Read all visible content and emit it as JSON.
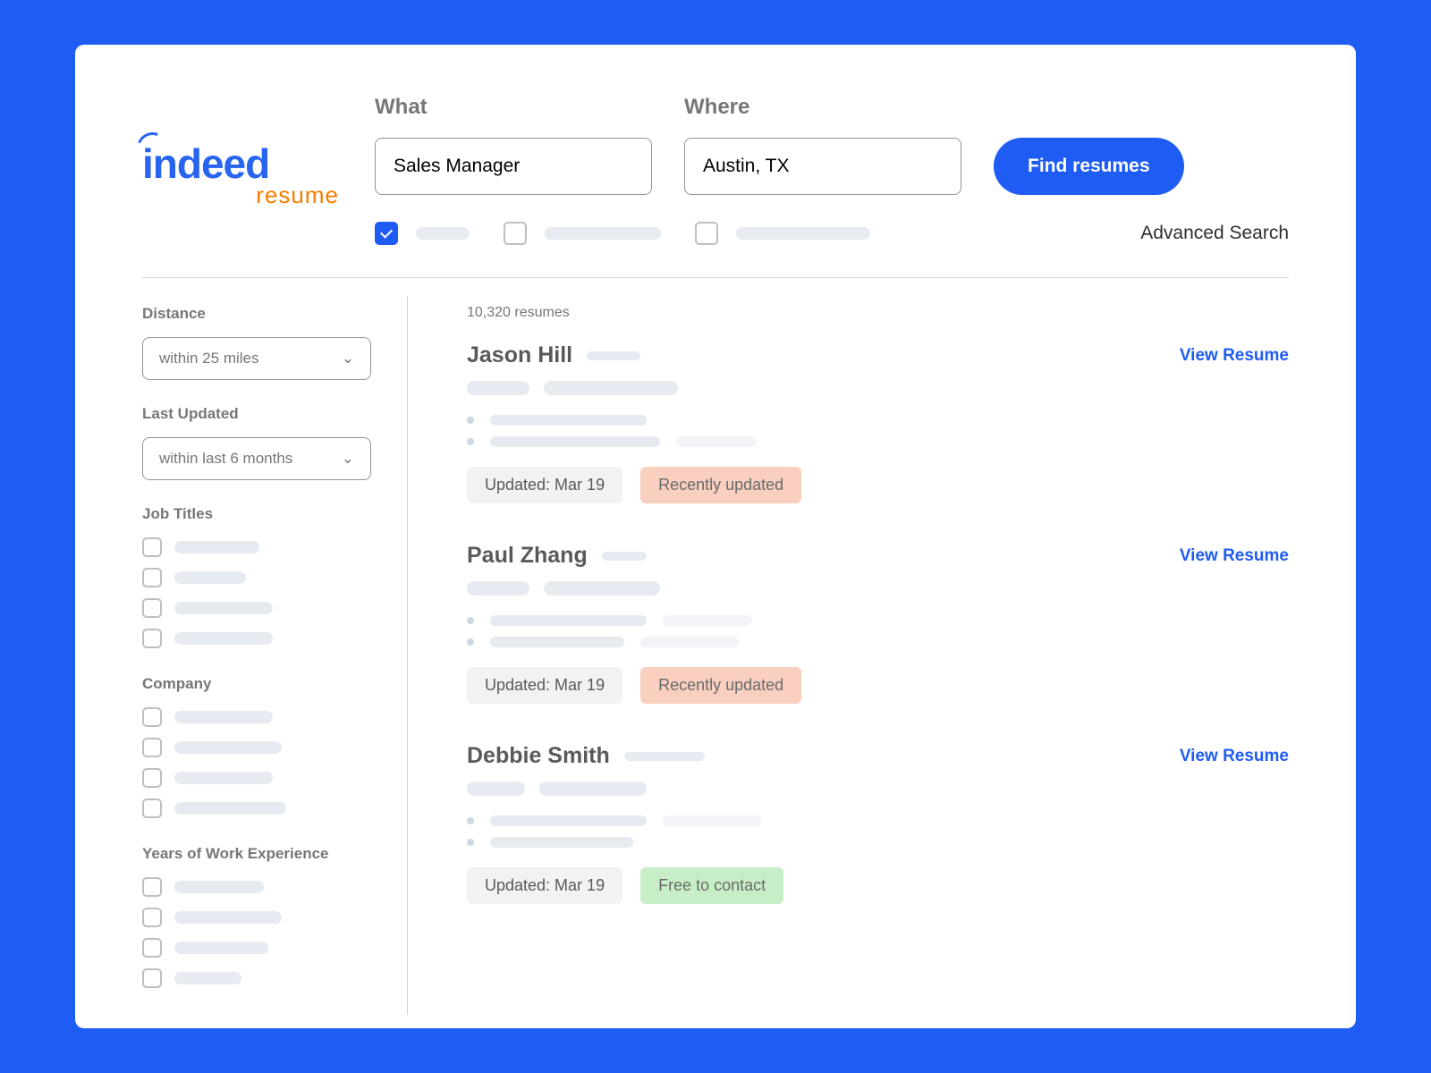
{
  "logo": {
    "brand": "indeed",
    "sub": "resume"
  },
  "search": {
    "what_label": "What",
    "where_label": "Where",
    "what_value": "Sales Manager",
    "where_value": "Austin, TX",
    "button": "Find resumes",
    "advanced": "Advanced Search"
  },
  "filters": {
    "distance_label": "Distance",
    "distance_value": "within 25 miles",
    "updated_label": "Last Updated",
    "updated_value": "within last 6 months",
    "job_titles_label": "Job Titles",
    "company_label": "Company",
    "experience_label": "Years of Work Experience"
  },
  "results": {
    "count": "10,320 resumes",
    "view_label": "View Resume",
    "items": [
      {
        "name": "Jason Hill",
        "updated": "Updated: Mar 19",
        "badge": "Recently updated",
        "badge_type": "orange"
      },
      {
        "name": "Paul Zhang",
        "updated": "Updated: Mar 19",
        "badge": "Recently updated",
        "badge_type": "orange"
      },
      {
        "name": "Debbie Smith",
        "updated": "Updated: Mar 19",
        "badge": "Free to contact",
        "badge_type": "green"
      }
    ]
  }
}
